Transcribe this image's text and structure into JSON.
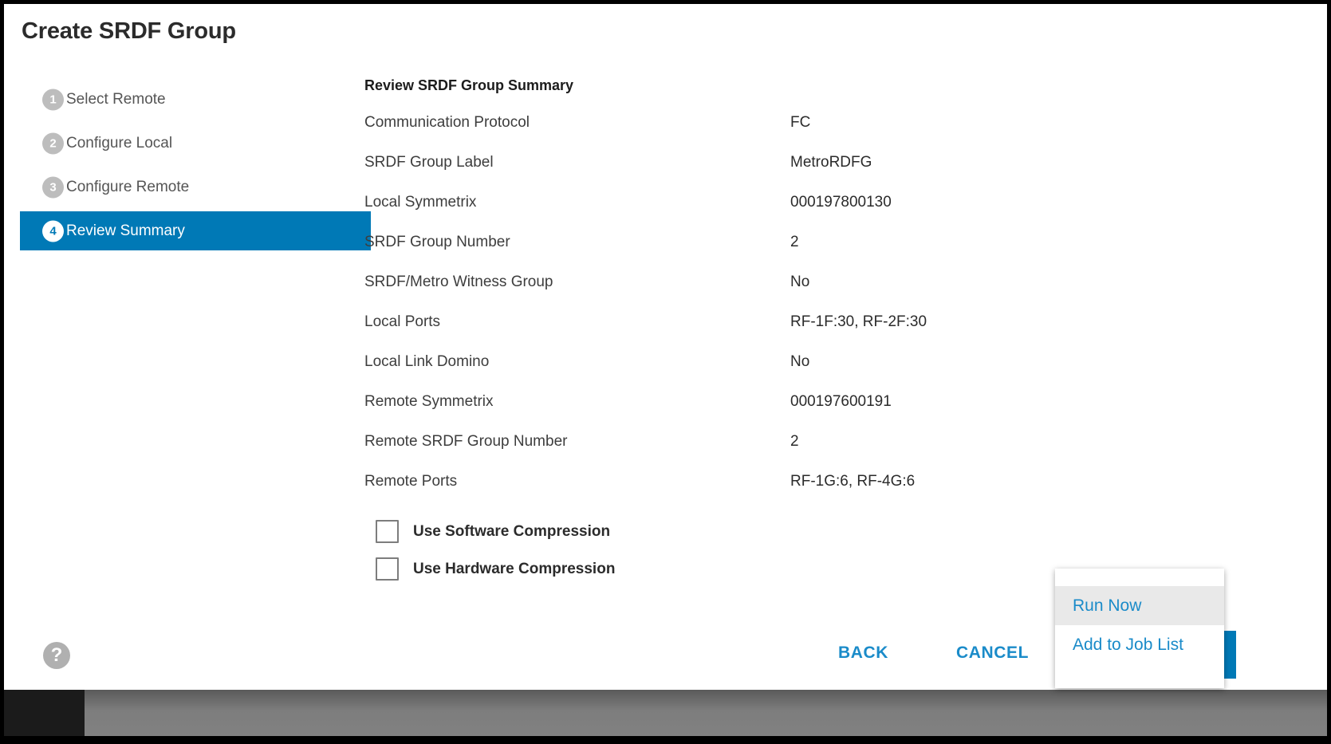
{
  "dialog": {
    "title": "Create SRDF Group"
  },
  "wizard": {
    "steps": [
      {
        "number": "1",
        "label": "Select Remote",
        "active": false
      },
      {
        "number": "2",
        "label": "Configure Local",
        "active": false
      },
      {
        "number": "3",
        "label": "Configure Remote",
        "active": false
      },
      {
        "number": "4",
        "label": "Review Summary",
        "active": true
      }
    ]
  },
  "summary": {
    "heading": "Review SRDF Group Summary",
    "rows": [
      {
        "label": "Communication Protocol",
        "value": "FC"
      },
      {
        "label": "SRDF Group Label",
        "value": "MetroRDFG"
      },
      {
        "label": "Local Symmetrix",
        "value": "000197800130"
      },
      {
        "label": "SRDF Group Number",
        "value": "2"
      },
      {
        "label": "SRDF/Metro Witness Group",
        "value": "No"
      },
      {
        "label": "Local Ports",
        "value": "RF-1F:30, RF-2F:30"
      },
      {
        "label": "Local Link Domino",
        "value": "No"
      },
      {
        "label": "Remote Symmetrix",
        "value": "000197600191"
      },
      {
        "label": "Remote SRDF Group Number",
        "value": "2"
      },
      {
        "label": "Remote Ports",
        "value": "RF-1G:6, RF-4G:6"
      }
    ],
    "checkboxes": [
      {
        "label": "Use Software Compression",
        "checked": false
      },
      {
        "label": "Use Hardware Compression",
        "checked": false
      }
    ]
  },
  "footer": {
    "help_icon": "?",
    "back_label": "BACK",
    "cancel_label": "CANCEL",
    "split_button_icon": "chevron-down-icon"
  },
  "action_menu": {
    "items": [
      {
        "label": "Run Now",
        "highlighted": true
      },
      {
        "label": "Add to Job List",
        "highlighted": false
      }
    ]
  },
  "colors": {
    "accent_blue": "#0079b6",
    "link_blue": "#1a8bc9",
    "step_badge_gray": "#bdbdbd",
    "menu_highlight": "#e9e9e9"
  }
}
